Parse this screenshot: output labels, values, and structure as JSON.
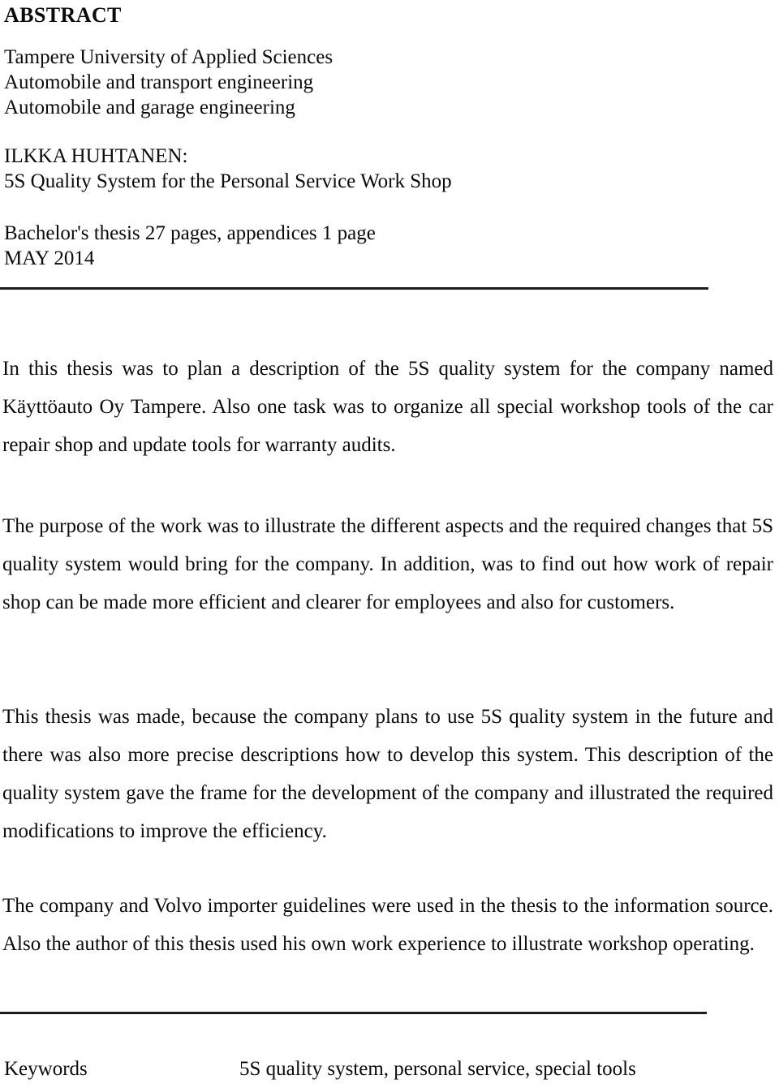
{
  "document": {
    "heading": "ABSTRACT",
    "institution": {
      "line1": "Tampere University of Applied Sciences",
      "line2": "Automobile and transport engineering",
      "line3": "Automobile and garage engineering"
    },
    "author_block": {
      "author": "ILKKA HUHTANEN:",
      "title": "5S Quality System for the Personal Service Work Shop"
    },
    "thesis_block": {
      "pages": "Bachelor's thesis 27 pages, appendices 1 page",
      "date": "MAY 2014"
    },
    "paragraphs": {
      "p1": "In this thesis was to plan a description of the 5S quality system for the company named Käyttöauto Oy Tampere. Also one task was to organize all special workshop tools of the car repair shop and update tools for warranty audits.",
      "p2": "The purpose of the work was to illustrate the different aspects and the required changes that 5S quality system would bring for the company. In addition, was to find out how work of repair shop can be made more efficient and clearer for employees and also for customers.",
      "p3": "This thesis was made, because the company plans to use 5S quality system in the future and there was also more precise descriptions how to develop this system. This description of the quality system gave the frame for the development of the company and illustrated the required modifications to improve the efficiency.",
      "p4": "The company and Volvo importer guidelines were used in the thesis to the information source. Also the author of this thesis used his own work experience to illustrate workshop operating."
    },
    "keywords": {
      "label": "Keywords",
      "value": "5S quality system, personal service, special tools"
    },
    "colors": {
      "text": "#0b0b0b",
      "rule": "#1c1c1c",
      "background": "#ffffff"
    }
  }
}
